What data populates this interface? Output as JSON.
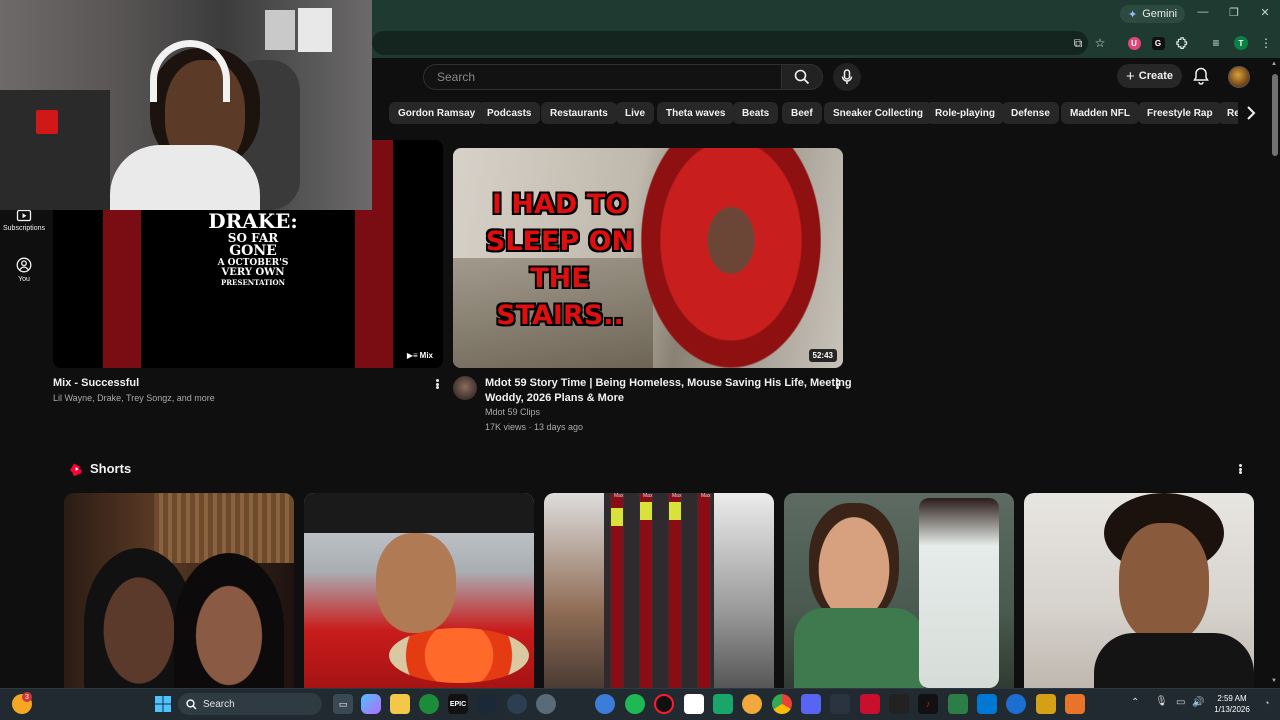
{
  "browser": {
    "gemini_label": "Gemini",
    "window_controls": [
      "—",
      "❐",
      "✕"
    ],
    "extension_badges": [
      "T",
      "G"
    ]
  },
  "header": {
    "search_placeholder": "Search",
    "create_label": "Create"
  },
  "chips": [
    "Gordon Ramsay",
    "Podcasts",
    "Restaurants",
    "Live",
    "Theta waves",
    "Beats",
    "Beef",
    "Sneaker Collecting",
    "Role-playing",
    "Defense",
    "Madden NFL",
    "Freestyle Rap",
    "Rec"
  ],
  "sidebar": {
    "items": [
      {
        "label": "Subscriptions",
        "icon": "subscriptions-icon"
      },
      {
        "label": "You",
        "icon": "you-icon"
      }
    ]
  },
  "videos": [
    {
      "title": "Mix - Successful",
      "subtitle": "Lil Wayne, Drake, Trey Songz, and more",
      "badge": "Mix",
      "thumb_text": [
        "DRAKE:",
        "SO FAR",
        "GONE",
        "A OCTOBER'S",
        "VERY OWN",
        "PRESENTATION"
      ]
    },
    {
      "title_line1": "Mdot 59 Story Time | Being Homeless, Mouse Saving His Life, Meeting",
      "title_line2": "Woddy, 2026 Plans & More",
      "channel": "Mdot 59 Clips",
      "meta": "17K views · 13 days ago",
      "duration": "52:43",
      "thumb_text": [
        "I HAD TO",
        "SLEEP ON",
        "THE STAIRS.."
      ]
    }
  ],
  "shorts": {
    "heading": "Shorts",
    "max_labels": [
      "Max",
      "Max",
      "Max",
      "Max"
    ]
  },
  "taskbar": {
    "search_label": "Search",
    "time": "2:59 AM",
    "date": "1/13/2026",
    "notification_count": "3"
  },
  "colors": {
    "youtube_red": "#ff0000",
    "browser_green": "#1f3a31",
    "taskbar": "#202a30"
  }
}
